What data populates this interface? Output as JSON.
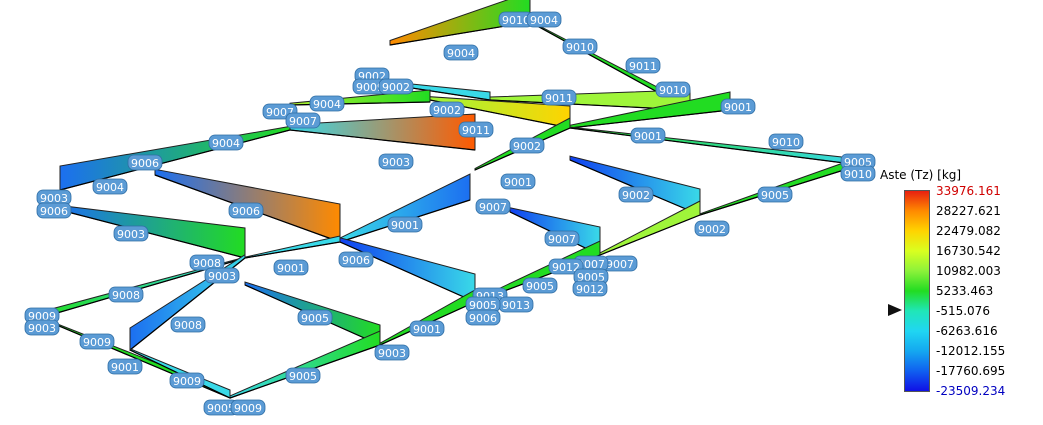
{
  "legend": {
    "title": "Aste (Tz) [kg]",
    "values": [
      "33976.161",
      "28227.621",
      "22479.082",
      "16730.542",
      "10982.003",
      "5233.463",
      "-515.076",
      "-6263.616",
      "-12012.155",
      "-17760.695",
      "-23509.234"
    ],
    "max_color": "#d00000",
    "min_color": "#0000c0",
    "marker_value": "-515.076"
  },
  "node_labels": [
    "9010",
    "9004",
    "9004",
    "9010",
    "9011",
    "9002",
    "9009",
    "9002",
    "9011",
    "9010",
    "9001",
    "9004",
    "9007",
    "9002",
    "9011",
    "9001",
    "9002",
    "9010",
    "9006",
    "9004",
    "9007",
    "9003",
    "9004",
    "9001",
    "9002",
    "9005",
    "9010",
    "9006",
    "9007",
    "9005",
    "9001",
    "9003",
    "9007",
    "9002",
    "9001",
    "9008",
    "9003",
    "9006",
    "9007",
    "9007",
    "9012",
    "9005",
    "9012",
    "9005",
    "9008",
    "9003",
    "9006",
    "9013",
    "9013",
    "9005",
    "9009",
    "9003",
    "9006",
    "9008",
    "9001",
    "9005",
    "9009",
    "9003",
    "9001",
    "9009",
    "9005",
    "9005",
    "9009"
  ],
  "colors": {
    "grid_beam": "#39d9e8",
    "accent": "#5b9bd5"
  }
}
